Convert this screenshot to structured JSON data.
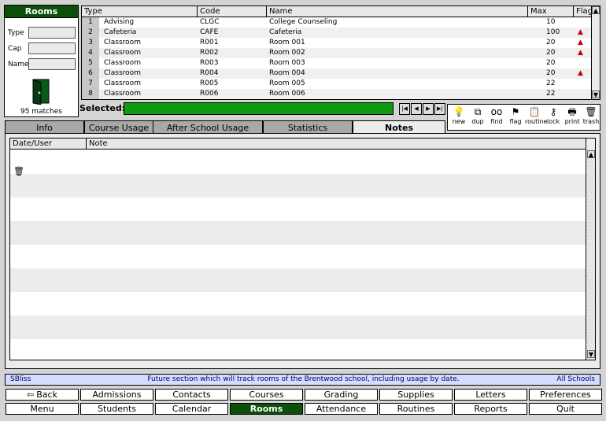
{
  "search_panel": {
    "title": "Rooms",
    "fields": [
      {
        "label": "Type",
        "value": ""
      },
      {
        "label": "Cap",
        "value": ""
      },
      {
        "label": "Name",
        "value": ""
      }
    ],
    "match_count": "95 matches"
  },
  "table": {
    "columns": [
      "Type",
      "Code",
      "Name",
      "Max",
      "Flag"
    ],
    "rows": [
      {
        "n": "1",
        "type": "Advising",
        "code": "CLGC",
        "name": "College Counseling",
        "max": "10",
        "flag": false
      },
      {
        "n": "2",
        "type": "Cafeteria",
        "code": "CAFE",
        "name": "Cafeteria",
        "max": "100",
        "flag": true
      },
      {
        "n": "3",
        "type": "Classroom",
        "code": "R001",
        "name": "Room 001",
        "max": "20",
        "flag": true
      },
      {
        "n": "4",
        "type": "Classroom",
        "code": "R002",
        "name": "Room 002",
        "max": "20",
        "flag": true
      },
      {
        "n": "5",
        "type": "Classroom",
        "code": "R003",
        "name": "Room 003",
        "max": "20",
        "flag": false
      },
      {
        "n": "6",
        "type": "Classroom",
        "code": "R004",
        "name": "Room 004",
        "max": "20",
        "flag": true
      },
      {
        "n": "7",
        "type": "Classroom",
        "code": "R005",
        "name": "Room 005",
        "max": "22",
        "flag": false
      },
      {
        "n": "8",
        "type": "Classroom",
        "code": "R006",
        "name": "Room 006",
        "max": "22",
        "flag": false
      }
    ]
  },
  "selected": {
    "label": "Selected:",
    "value": ""
  },
  "toolbar": [
    {
      "label": "new",
      "icon": "lightbulb-icon",
      "glyph": "💡"
    },
    {
      "label": "dup",
      "icon": "duplicate-icon",
      "glyph": "⧉"
    },
    {
      "label": "find",
      "icon": "glasses-icon",
      "glyph": "oo"
    },
    {
      "label": "flag",
      "icon": "flag-icon",
      "glyph": "⚑"
    },
    {
      "label": "routine",
      "icon": "clipboard-icon",
      "glyph": "📋"
    },
    {
      "label": "lock",
      "icon": "key-icon",
      "glyph": "⚷"
    },
    {
      "label": "print",
      "icon": "printer-icon",
      "glyph": "🖶"
    },
    {
      "label": "trash",
      "icon": "trash-icon",
      "glyph": "🗑"
    }
  ],
  "tabs": [
    {
      "label": "Info",
      "active": false
    },
    {
      "label": "Course Usage",
      "active": false
    },
    {
      "label": "After School Usage",
      "active": false
    },
    {
      "label": "Statistics",
      "active": false
    },
    {
      "label": "Notes",
      "active": true
    }
  ],
  "notes": {
    "columns": [
      "Date/User",
      "Note"
    ],
    "rows": []
  },
  "status_bar": {
    "left": "SBliss",
    "center": "Future section which will track rooms of the Brentwood school, including usage by date.",
    "right": "All Schools"
  },
  "nav": {
    "row1": [
      "Back",
      "Admissions",
      "Contacts",
      "Courses",
      "Grading",
      "Supplies",
      "Letters",
      "Preferences"
    ],
    "row2": [
      "Menu",
      "Students",
      "Calendar",
      "Rooms",
      "Attendance",
      "Routines",
      "Reports",
      "Quit"
    ],
    "active": "Rooms"
  },
  "colors": {
    "header_green": "#0a4f0a",
    "selected_green": "#0f9a0f",
    "flag_red": "#c00000",
    "status_bg": "#d6dcff"
  }
}
